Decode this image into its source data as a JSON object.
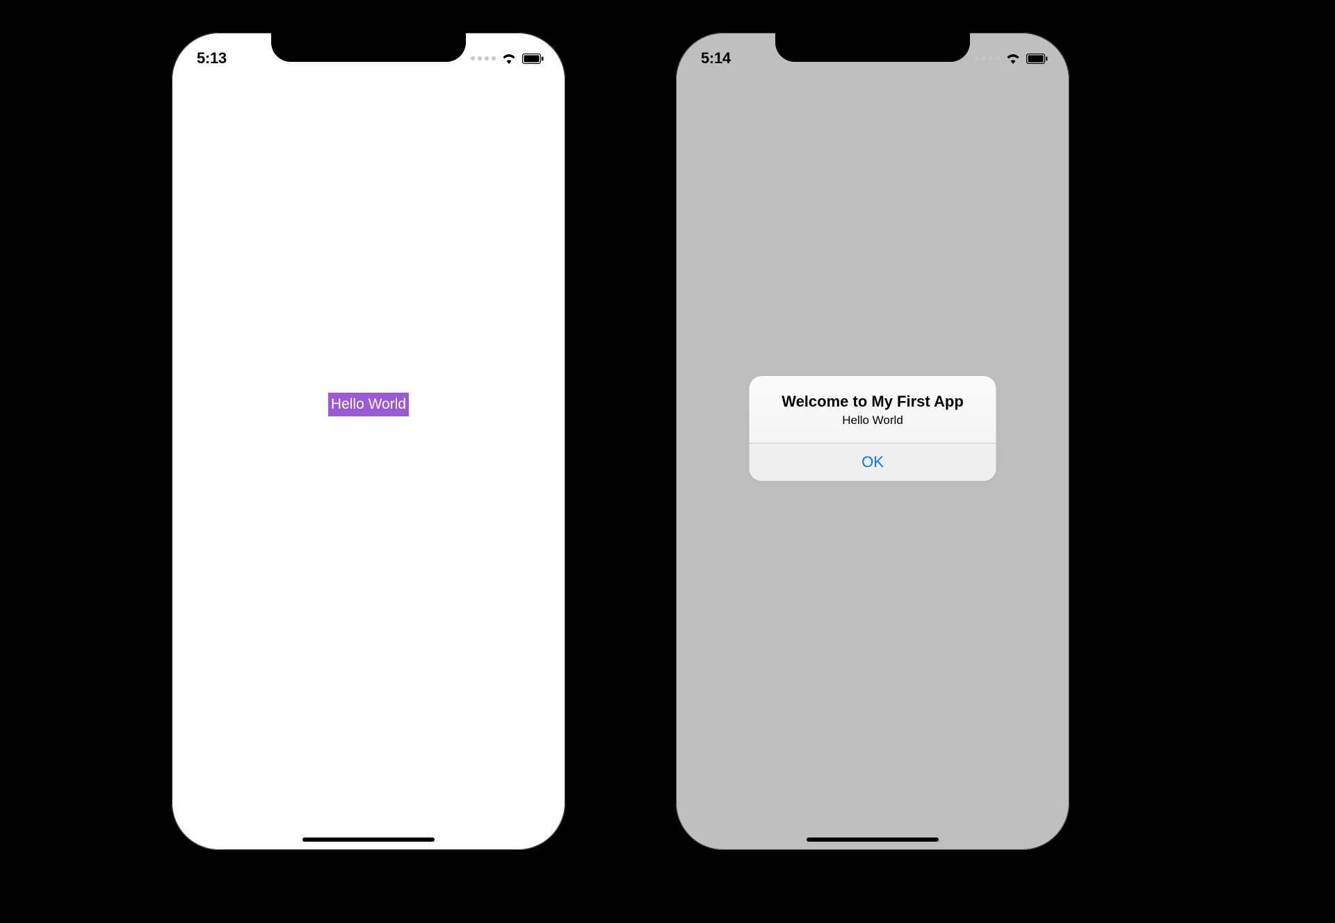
{
  "phone_left": {
    "status": {
      "time": "5:13"
    },
    "button_label": "Hello World"
  },
  "phone_right": {
    "status": {
      "time": "5:14"
    },
    "alert": {
      "title": "Welcome to My First App",
      "message": "Hello World",
      "action": "OK"
    }
  },
  "colors": {
    "button_bg": "#9b59d6",
    "alert_action": "#007aff"
  }
}
